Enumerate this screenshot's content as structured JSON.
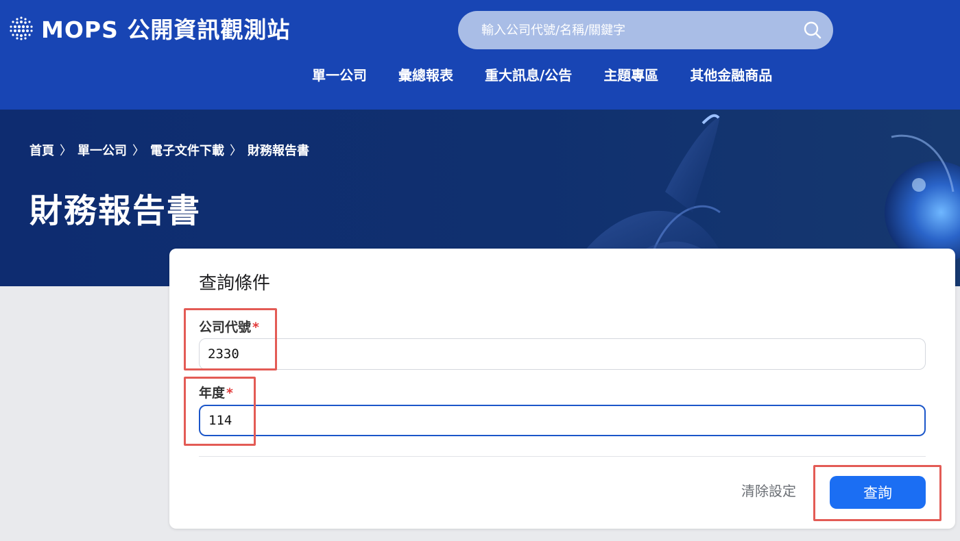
{
  "header": {
    "logo_text": "MOPS 公開資訊觀測站",
    "search_placeholder": "輸入公司代號/名稱/關鍵字",
    "nav": [
      {
        "label": "單一公司"
      },
      {
        "label": "彙總報表"
      },
      {
        "label": "重大訊息/公告"
      },
      {
        "label": "主題專區"
      },
      {
        "label": "其他金融商品"
      }
    ]
  },
  "banner": {
    "breadcrumb": [
      {
        "label": "首頁"
      },
      {
        "label": "單一公司"
      },
      {
        "label": "電子文件下載"
      },
      {
        "label": "財務報告書"
      }
    ],
    "separator": "〉",
    "title": "財務報告書"
  },
  "form": {
    "title": "查詢條件",
    "company": {
      "label": "公司代號",
      "required_mark": "*",
      "value": "2330"
    },
    "year": {
      "label": "年度",
      "required_mark": "*",
      "value": "114"
    },
    "clear_label": "清除設定",
    "submit_label": "查詢"
  },
  "icons": {
    "search": "search-icon",
    "logo": "logo-dots-icon"
  },
  "colors": {
    "header_bg": "#1845b4",
    "banner_bg": "#0e2c70",
    "primary_button": "#1b6ef3",
    "required": "#e23b3b",
    "annotation": "#e35b55"
  }
}
